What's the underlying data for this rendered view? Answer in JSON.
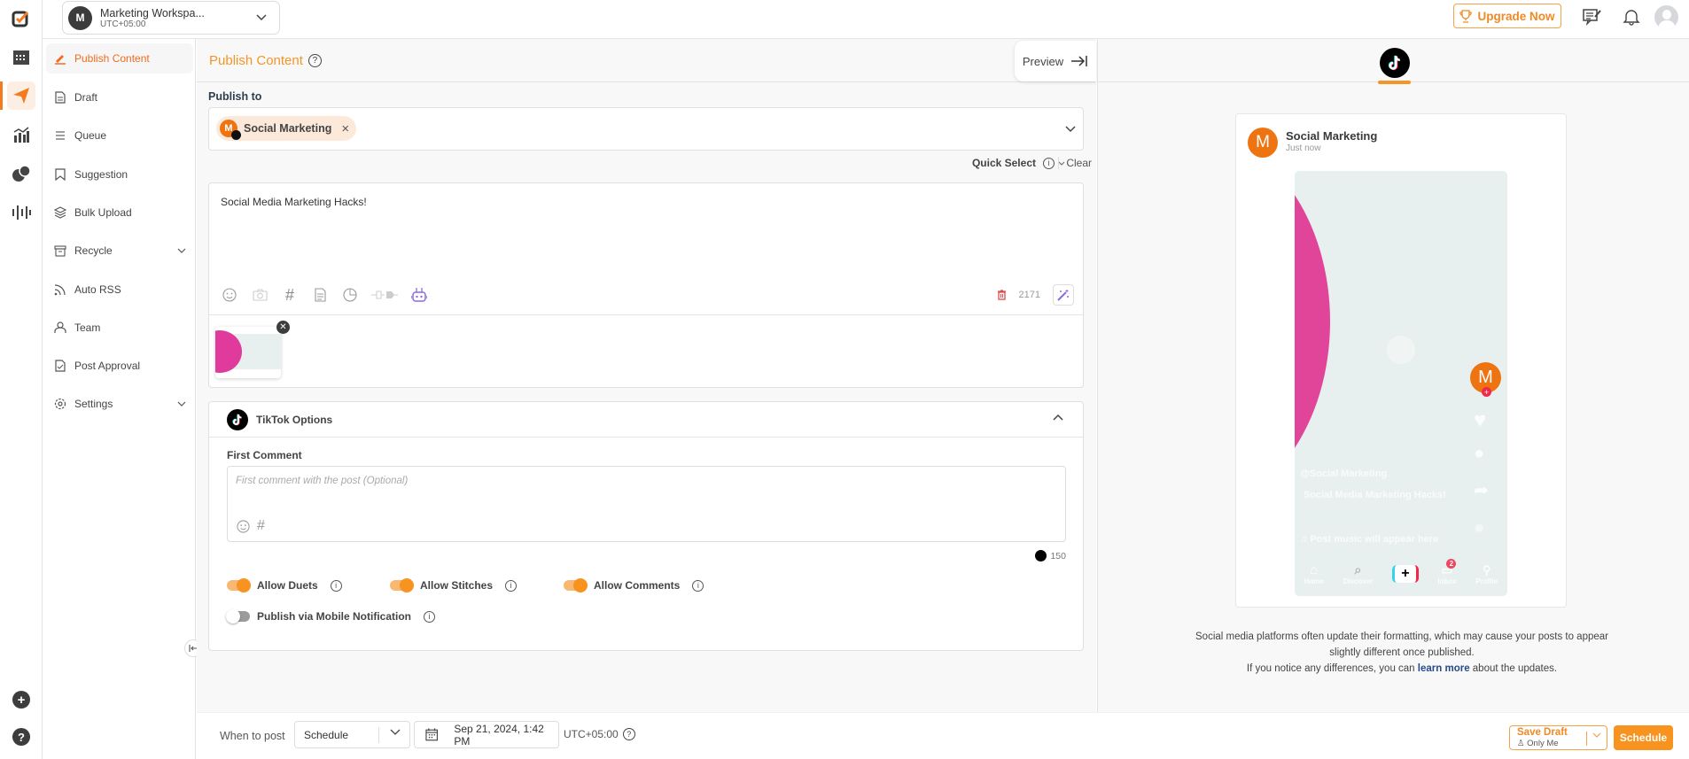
{
  "workspace": {
    "initial": "M",
    "name": "Marketing Workspa...",
    "timezone": "UTC+05:00"
  },
  "topbar": {
    "upgrade_label": "Upgrade Now"
  },
  "rail": {
    "items": [
      "logo",
      "calendar",
      "publish",
      "analytics",
      "engage",
      "listening"
    ],
    "bottom": [
      "add",
      "help"
    ]
  },
  "sidebar": {
    "items": [
      {
        "label": "Publish Content",
        "icon": "pencil-icon",
        "active": true
      },
      {
        "label": "Draft",
        "icon": "document-icon"
      },
      {
        "label": "Queue",
        "icon": "list-icon"
      },
      {
        "label": "Suggestion",
        "icon": "bookmark-icon"
      },
      {
        "label": "Bulk Upload",
        "icon": "layers-icon"
      },
      {
        "label": "Recycle",
        "icon": "archive-icon",
        "expandable": true
      },
      {
        "label": "Auto RSS",
        "icon": "rss-icon"
      },
      {
        "label": "Team",
        "icon": "user-icon"
      },
      {
        "label": "Post Approval",
        "icon": "file-check-icon"
      },
      {
        "label": "Settings",
        "icon": "gear-icon",
        "expandable": true
      }
    ]
  },
  "main": {
    "title": "Publish Content",
    "preview_label": "Preview",
    "publish_to_label": "Publish to",
    "selected_account": {
      "initial": "M",
      "name": "Social Marketing",
      "network": "TikTok"
    },
    "quick_select_label": "Quick Select",
    "clear_label": "Clear",
    "post_text": "Social Media Marketing Hacks!",
    "char_count": "2171",
    "tiktok_options": {
      "title": "TikTok Options",
      "first_comment_label": "First Comment",
      "first_comment_placeholder": "First comment with the post (Optional)",
      "first_comment_limit": "150",
      "toggles": [
        {
          "label": "Allow Duets",
          "on": true
        },
        {
          "label": "Allow Stitches",
          "on": true
        },
        {
          "label": "Allow Comments",
          "on": true
        },
        {
          "label": "Publish via Mobile Notification",
          "on": false
        }
      ]
    }
  },
  "bottom": {
    "when_label": "When to post",
    "when_value": "Schedule",
    "date_value": "Sep 21, 2024, 1:42 PM",
    "timezone": "UTC+05:00",
    "save_draft_label": "Save Draft",
    "save_draft_sub": "Only Me",
    "schedule_label": "Schedule"
  },
  "preview": {
    "account_initial": "M",
    "account_name": "Social Marketing",
    "time": "Just now",
    "handle": "@Social Marketing",
    "caption": "Social Media Marketing Hacks!",
    "music": "Post music will appear here",
    "nav": [
      "Home",
      "Discover",
      "+",
      "Inbox",
      "Profile"
    ],
    "inbox_badge": "2",
    "disclaimer_1": "Social media platforms often update their formatting, which may cause your posts to appear slightly different once published.",
    "disclaimer_2_pre": "If you notice any differences, you can ",
    "disclaimer_link": "learn more",
    "disclaimer_2_post": " about the updates.",
    "accent": "#f39527"
  }
}
